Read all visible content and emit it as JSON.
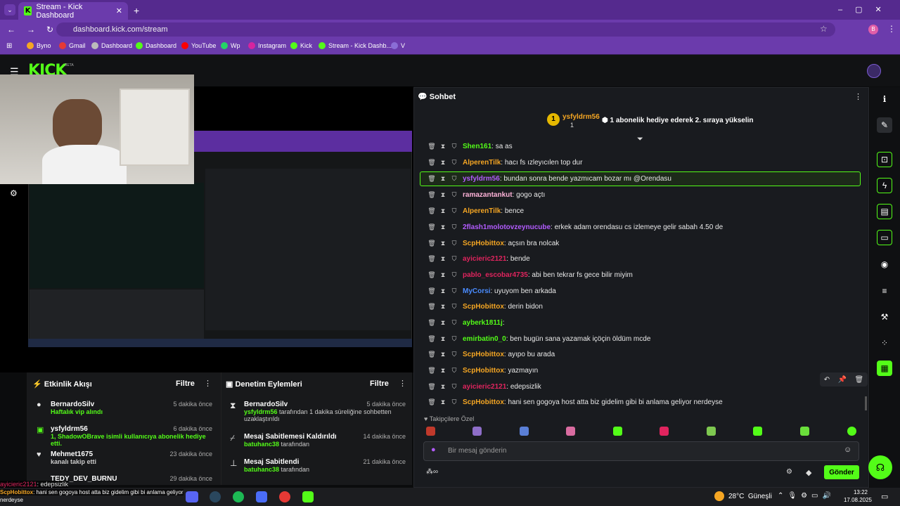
{
  "browser": {
    "tab_title": "Stream - Kick Dashboard",
    "url": "dashboard.kick.com/stream",
    "profile": "B",
    "bookmarks": [
      "Byno",
      "Gmail",
      "Dashboard",
      "Dashboard",
      "YouTube",
      "Wp",
      "Instagram",
      "Kick",
      "Stream - Kick Dashb...",
      "V"
    ]
  },
  "kick": {
    "logo": "KICK",
    "beta": "BETA"
  },
  "activity": {
    "title": "Etkinlik Akışı",
    "filter": "Filtre",
    "items": [
      {
        "name": "BernardoSilv",
        "desc": "Haftalık vip alındı",
        "time": "5 dakika önce"
      },
      {
        "name": "ysfyldrm56",
        "desc": "1, ShadowOBrave isimli kullanıcıya abonelik hediye etti.",
        "time": "6 dakika önce"
      },
      {
        "name": "Mehmet1675",
        "desc": "kanalı takip etti",
        "time": "23 dakika önce"
      },
      {
        "name": "TEDY_DEV_BURNU",
        "desc": "",
        "time": "29 dakika önce"
      }
    ]
  },
  "moderation": {
    "title": "Denetim Eylemleri",
    "filter": "Filtre",
    "items": [
      {
        "name": "BernardoSilv",
        "desc1": "ysfyldrm56",
        "desc2": " tarafından 1 dakika süreliğine sohbetten",
        "desc3": "uzaklaştırıldı",
        "time": "5 dakika önce"
      },
      {
        "name": "Mesaj Sabitlemesi Kaldırıldı",
        "desc1": "batuhanc38",
        "desc2": " tarafından",
        "time": "14 dakika önce"
      },
      {
        "name": "Mesaj Sabitlendi",
        "desc1": "batuhanc38",
        "desc2": " tarafından",
        "time": "21 dakika önce"
      }
    ]
  },
  "chat": {
    "title": "Sohbet",
    "pinned_user": "ysfyldrm56",
    "pinned_count": "1",
    "pinned_text": "1 abonelik hediye ederek 2. sıraya yükselin",
    "messages": [
      {
        "user": "Shen161",
        "color": "#53fc18",
        "text": ": sa as"
      },
      {
        "user": "AlperenTilk",
        "color": "#f5a623",
        "text": ": hacı fs ızleyıcılen top dur"
      },
      {
        "user": "ysfyldrm56",
        "color": "#b35cff",
        "text": ": bundan sonra bende yazmıcam bozar mı @Orendasu"
      },
      {
        "user": "ramazantankut",
        "color": "#ffb3d9",
        "text": ": gogo açtı"
      },
      {
        "user": "AlperenTilk",
        "color": "#f5a623",
        "text": ": bence"
      },
      {
        "user": "2flash1molotovzeynucube",
        "color": "#b35cff",
        "text": ": erkek adam orendasu cs izlemeye gelir sabah 4.50 de"
      },
      {
        "user": "ScpHobittox",
        "color": "#f5a623",
        "text": ": açsın bra nolcak"
      },
      {
        "user": "ayicieric2121",
        "color": "#e0245e",
        "text": ": bende"
      },
      {
        "user": "pablo_escobar4735",
        "color": "#e0245e",
        "text": ": abi ben tekrar fs gece bilir miyim"
      },
      {
        "user": "MyCorsi",
        "color": "#4a8cff",
        "text": ": uyuyom ben arkada"
      },
      {
        "user": "ScpHobittox",
        "color": "#f5a623",
        "text": ": derin bidon"
      },
      {
        "user": "ayberk1811j",
        "color": "#53fc18",
        "text": ":"
      },
      {
        "user": "emirbatin0_0",
        "color": "#53fc18",
        "text": ": ben bugün sana yazamak içöçin öldüm mcde"
      },
      {
        "user": "ScpHobittox",
        "color": "#f5a623",
        "text": ": ayıpo bu arada"
      },
      {
        "user": "ScpHobittox",
        "color": "#f5a623",
        "text": ": yazmayın"
      },
      {
        "user": "ayicieric2121",
        "color": "#e0245e",
        "text": ": edepsizlik"
      },
      {
        "user": "ScpHobittox",
        "color": "#f5a623",
        "text": ": hani sen gogoya host atta biz gidelim gibi bi anlama geliyor nerdeyse"
      }
    ],
    "followers_label": "Takipçilere Özel",
    "input_placeholder": "Bir mesaj gönderin",
    "send": "Gönder"
  },
  "overlay": {
    "line1_user": "ayicieric2121",
    "line1_text": ": edepsizlik",
    "line2_user": "ScpHobittox",
    "line2_text": ": hani sen gogoya host atta biz gidelim gibi bi anlama geliyor",
    "line3": "nerdeyse"
  },
  "taskbar": {
    "weather": "28°C  Güneşli",
    "time": "13:22",
    "date": "17.08.2025"
  }
}
